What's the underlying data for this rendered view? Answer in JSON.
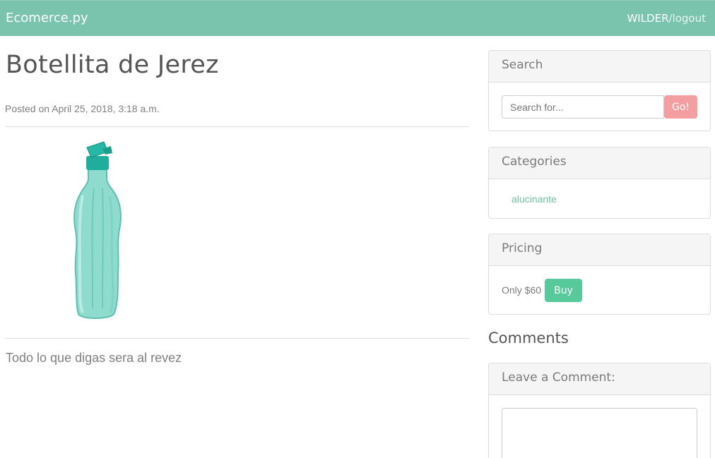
{
  "navbar": {
    "brand": "Ecomerce.py",
    "username": "WILDER",
    "separator": "/",
    "logout": "logout"
  },
  "post": {
    "title": "Botellita de Jerez",
    "meta": "Posted on April 25, 2018, 3:18 a.m.",
    "image_icon": "water-bottle-image",
    "body": "Todo lo que digas sera al revez"
  },
  "sidebar": {
    "search": {
      "heading": "Search",
      "placeholder": "Search for...",
      "button": "Go!"
    },
    "categories": {
      "heading": "Categories",
      "items": [
        "alucinante"
      ]
    },
    "pricing": {
      "heading": "Pricing",
      "text": "Only $60",
      "button": "Buy"
    },
    "comments": {
      "title": "Comments",
      "heading": "Leave a Comment:",
      "value": ""
    }
  },
  "colors": {
    "navbar": "#7ac4ae",
    "go_button": "#f59ea1",
    "buy_button": "#57c99a",
    "link": "#6ebfa5"
  }
}
